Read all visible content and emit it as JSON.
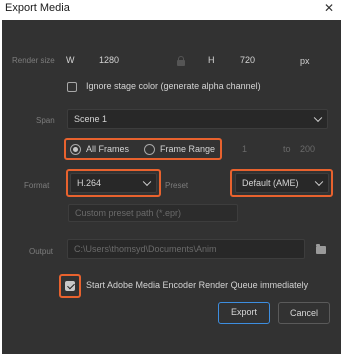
{
  "window": {
    "title": "Export Media",
    "close_icon": "close-icon"
  },
  "render_size": {
    "label": "Render size",
    "w_label": "W",
    "width": "1280",
    "h_label": "H",
    "height": "720",
    "unit": "px",
    "lock_icon": "lock-icon"
  },
  "ignore_stage_color": {
    "label": "Ignore stage color (generate alpha channel)",
    "checked": false
  },
  "span": {
    "label": "Span",
    "value": "Scene 1"
  },
  "frames": {
    "all_frames": {
      "label": "All Frames",
      "selected": true
    },
    "frame_range": {
      "label": "Frame Range",
      "selected": false
    },
    "from": "1",
    "to_label": "to",
    "to": "200"
  },
  "format": {
    "label": "Format",
    "value": "H.264"
  },
  "preset": {
    "label": "Preset",
    "value": "Default (AME)"
  },
  "custom_preset": {
    "placeholder": "Custom preset path (*.epr)"
  },
  "output": {
    "label": "Output",
    "value": "C:\\Users\\thomsyd\\Documents\\Anim",
    "folder_icon": "folder-icon"
  },
  "start_ame": {
    "label": "Start Adobe Media Encoder Render Queue immediately",
    "checked": true
  },
  "buttons": {
    "export": "Export",
    "cancel": "Cancel"
  },
  "colors": {
    "highlight": "#e8622e",
    "primary_border": "#3d8ee0",
    "dialog_bg": "#323232"
  }
}
